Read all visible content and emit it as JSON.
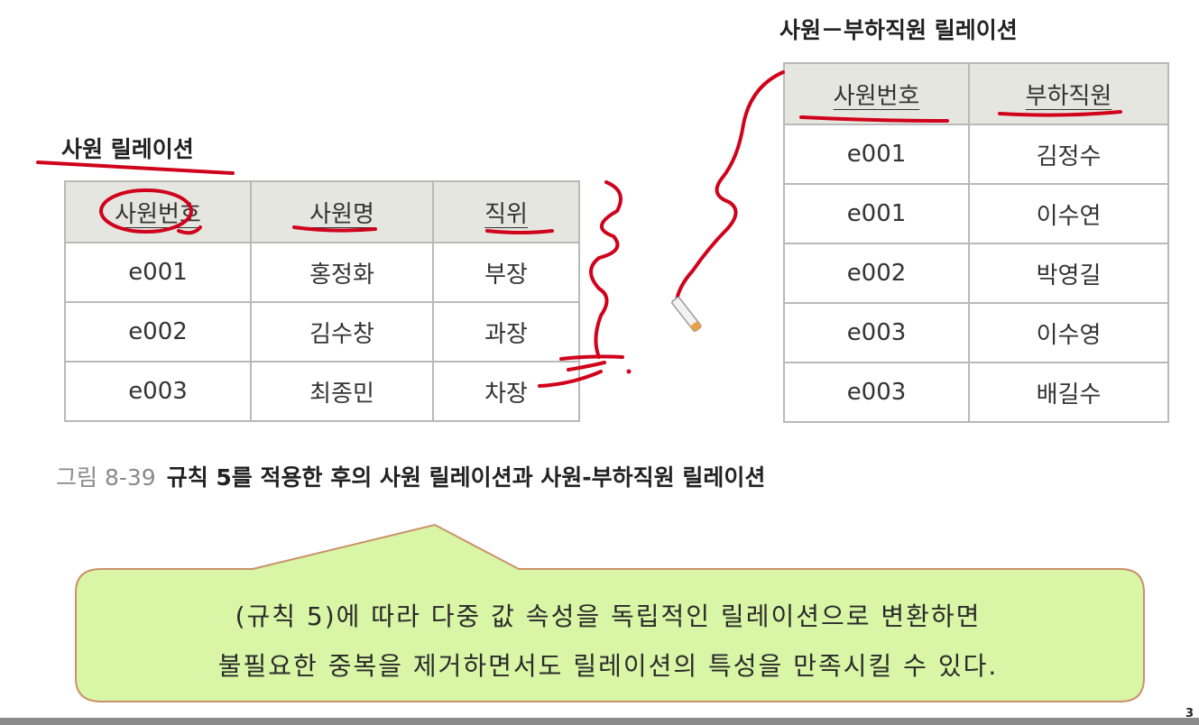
{
  "left_relation": {
    "title": "사원 릴레이션",
    "headers": [
      "사원번호",
      "사원명",
      "직위"
    ],
    "rows": [
      [
        "e001",
        "홍정화",
        "부장"
      ],
      [
        "e002",
        "김수창",
        "과장"
      ],
      [
        "e003",
        "최종민",
        "차장"
      ]
    ]
  },
  "right_relation": {
    "title": "사원－부하직원 릴레이션",
    "headers": [
      "사원번호",
      "부하직원"
    ],
    "rows": [
      [
        "e001",
        "김정수"
      ],
      [
        "e001",
        "이수연"
      ],
      [
        "e002",
        "박영길"
      ],
      [
        "e003",
        "이수영"
      ],
      [
        "e003",
        "배길수"
      ]
    ]
  },
  "figure": {
    "number": "그림 8-39",
    "caption": "규칙 5를 적용한 후의 사원 릴레이션과 사원-부하직원 릴레이션"
  },
  "callout": {
    "line1": "(규칙 5)에 따라 다중 값 속성을 독립적인 릴레이션으로 변환하면",
    "line2": "불필요한 중복을 제거하면서도 릴레이션의 특성을 만족시킬 수 있다."
  },
  "page_number": "3",
  "colors": {
    "header_bg": "#e6e6e0",
    "border": "#b9b9b9",
    "annotation_red": "#d0021b",
    "callout_fill": "#d9f5a6",
    "callout_border": "#c9916a"
  }
}
